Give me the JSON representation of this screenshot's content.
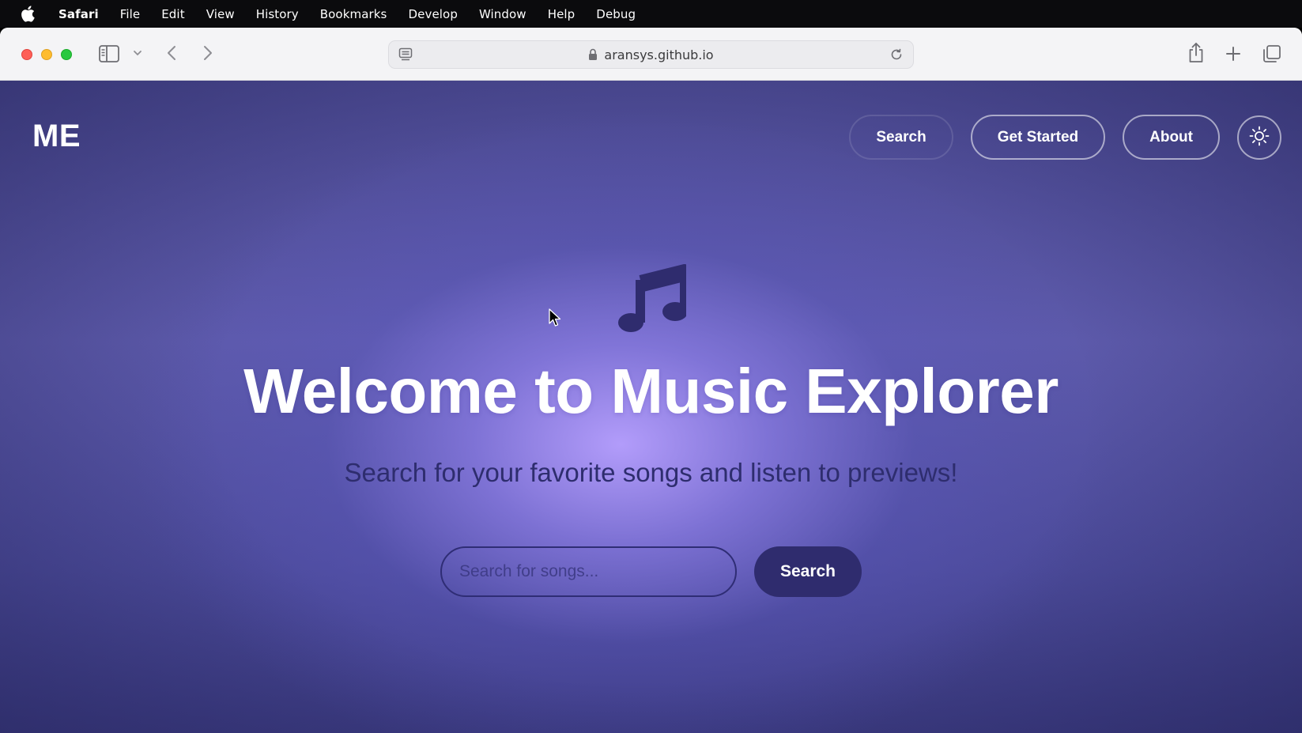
{
  "menubar": {
    "app_name": "Safari",
    "items": [
      "File",
      "Edit",
      "View",
      "History",
      "Bookmarks",
      "Develop",
      "Window",
      "Help",
      "Debug"
    ]
  },
  "browser": {
    "url": "aransys.github.io"
  },
  "site": {
    "logo": "ME",
    "nav": {
      "search_label": "Search",
      "get_started_label": "Get Started",
      "about_label": "About"
    },
    "hero": {
      "title": "Welcome to Music Explorer",
      "subtitle": "Search for your favorite songs and listen to previews!",
      "search_placeholder": "Search for songs...",
      "search_button": "Search"
    },
    "colors": {
      "accent_dark": "#2f2c6e",
      "background_purple": "#5d5aab",
      "glow": "#b7a0ff"
    },
    "icons": {
      "hero": "music-note-icon",
      "theme": "sun-icon"
    }
  }
}
